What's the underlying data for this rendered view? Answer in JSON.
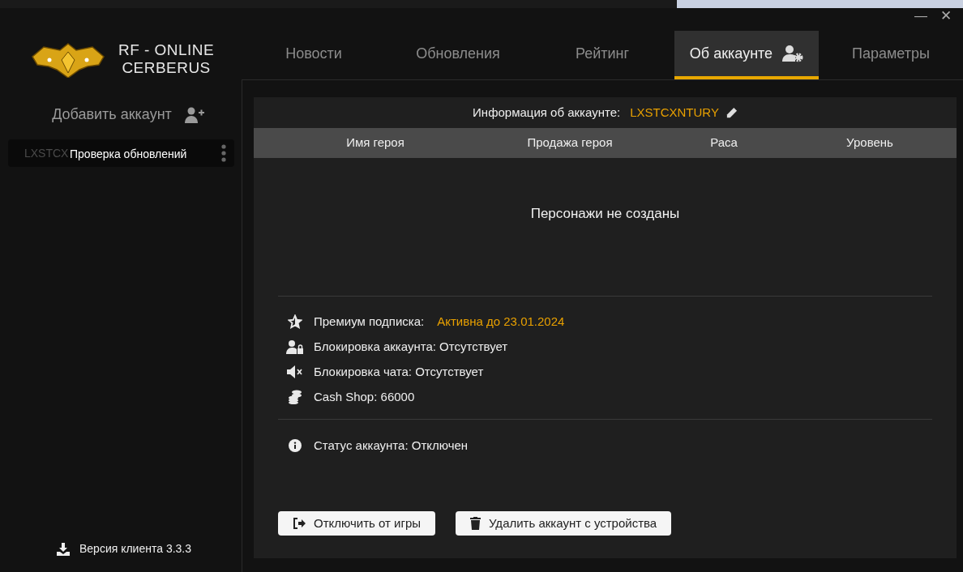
{
  "logo": {
    "line1": "RF - ONLINE",
    "line2": "CERBERUS"
  },
  "window_controls": {
    "minimize": "—",
    "close": "✕"
  },
  "tabs": [
    {
      "kind": "text",
      "label": "Новости",
      "selected": false
    },
    {
      "kind": "text",
      "label": "Обновления",
      "selected": false
    },
    {
      "kind": "text",
      "label": "Рейтинг",
      "selected": false
    },
    {
      "kind": "account",
      "label": "Об аккаунте",
      "selected": true
    },
    {
      "kind": "text",
      "label": "Параметры",
      "selected": false
    }
  ],
  "sidebar": {
    "add_account": "Добавить аккаунт",
    "accounts": [
      {
        "name": "LXSTCX",
        "tooltip": "Проверка обновлений"
      }
    ],
    "version": "Версия клиента 3.3.3"
  },
  "account": {
    "info_label": "Информация об аккаунте:",
    "login": "LXSTCXNTURY",
    "table": {
      "columns": [
        "Имя героя",
        "Продажа героя",
        "Раса",
        "Уровень"
      ],
      "empty": "Персонажи не созданы"
    },
    "details": [
      {
        "kind": "star",
        "label": "Премиум подписка:",
        "value": "Активна до 23.01.2024"
      },
      {
        "kind": "lock",
        "label": "Блокировка аккаунта: Отсутствует"
      },
      {
        "kind": "mute",
        "label": "Блокировка чата: Отсутствует"
      },
      {
        "kind": "coins",
        "label": "Cash Shop: 66000"
      }
    ],
    "status": "Статус аккаунта: Отключен",
    "buttons": [
      {
        "kind": "logout",
        "label": "Отключить от игры"
      },
      {
        "kind": "trash",
        "label": "Удалить аккаунт с устройства"
      }
    ]
  }
}
